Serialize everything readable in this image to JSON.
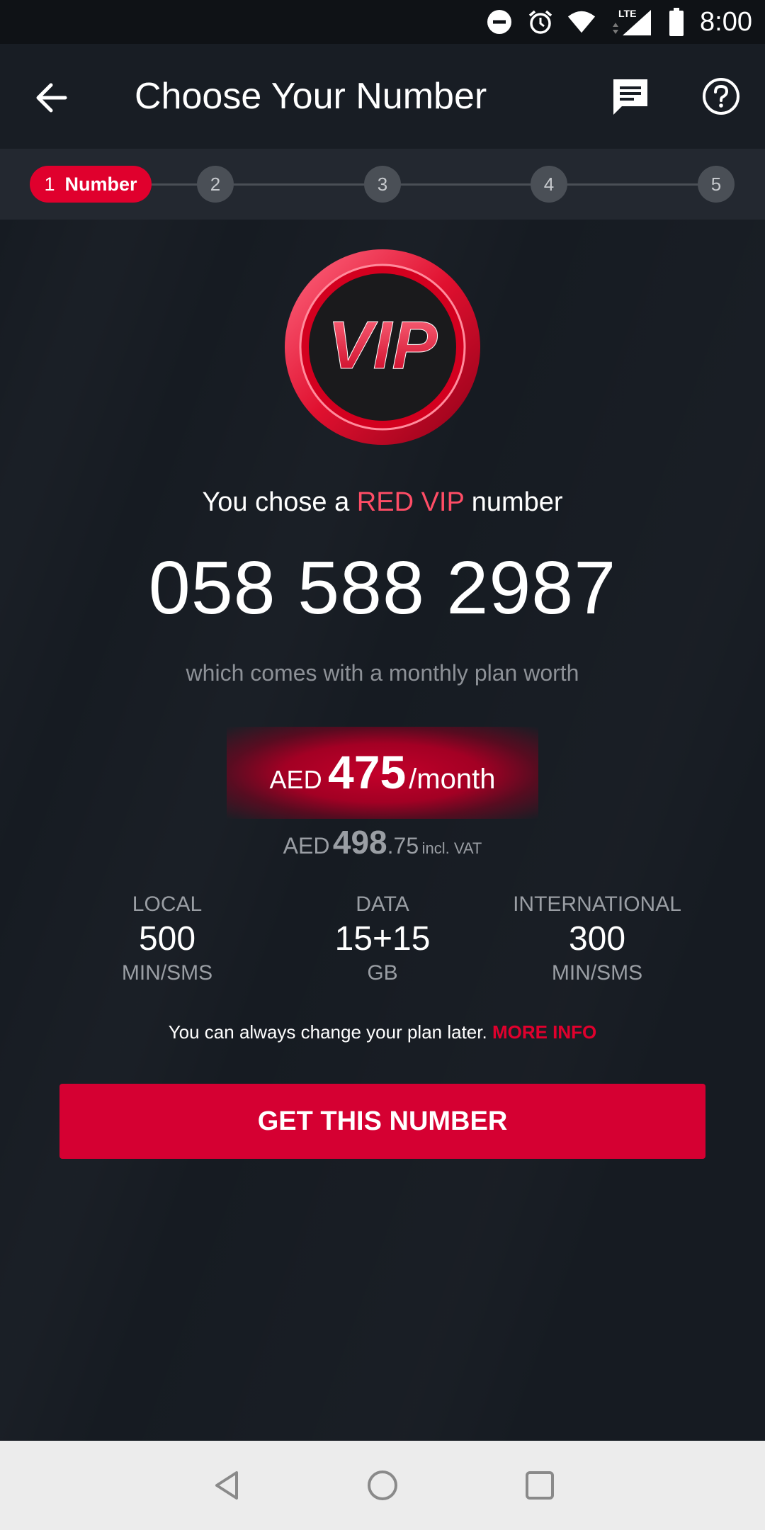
{
  "status_bar": {
    "time": "8:00",
    "network": "LTE",
    "icons": [
      "do-not-disturb-icon",
      "alarm-icon",
      "wifi-icon",
      "signal-icon",
      "battery-icon"
    ]
  },
  "app_bar": {
    "title": "Choose Your Number",
    "icons": [
      "back-arrow-icon",
      "chat-icon",
      "help-icon"
    ]
  },
  "stepper": {
    "active_number": "1",
    "active_label": "Number",
    "steps": [
      "2",
      "3",
      "4",
      "5"
    ]
  },
  "main": {
    "chose_prefix": "You chose a",
    "chose_highlight": "RED VIP",
    "chose_suffix": "number",
    "phone_number": "058 588 2987",
    "worth_text": "which comes with a monthly plan worth",
    "price": {
      "currency": "AED",
      "amount": "475",
      "period": "/month",
      "vat_currency": "AED",
      "vat_amount": "498",
      "vat_decimals": ".75",
      "vat_label": "incl. VAT"
    },
    "features": [
      {
        "label": "LOCAL",
        "value": "500",
        "unit": "MIN/SMS"
      },
      {
        "label": "DATA",
        "value": "15+15",
        "unit": "GB"
      },
      {
        "label": "INTERNATIONAL",
        "value": "300",
        "unit": "MIN/SMS"
      }
    ],
    "change_note": "You can always change your plan later.",
    "more_info": "MORE INFO",
    "cta_label": "GET THIS NUMBER",
    "badge_text": "VIP"
  },
  "colors": {
    "accent_red": "#e0002d",
    "background": "#161b22",
    "highlight_red": "#ff4d66"
  }
}
